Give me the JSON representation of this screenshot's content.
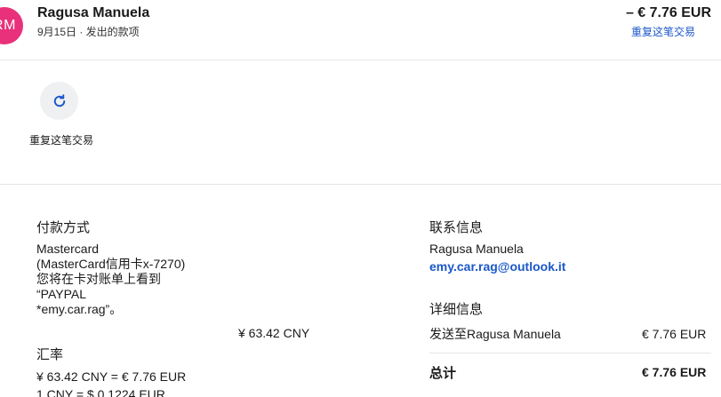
{
  "header": {
    "avatar_initials": "RM",
    "name": "Ragusa Manuela",
    "subtitle": "9月15日 · 发出的款项",
    "amount": "– € 7.76 EUR",
    "repeat_link": "重复这笔交易"
  },
  "actions": {
    "repeat_label": "重复这笔交易"
  },
  "payment": {
    "title": "付款方式",
    "lines": [
      "Mastercard",
      "(MasterCard信用卡x-7270)",
      "您将在卡对账单上看到",
      "“PAYPAL",
      "*emy.car.rag”。"
    ],
    "amount": "¥ 63.42 CNY"
  },
  "exchange": {
    "title": "汇率",
    "line1": "¥ 63.42 CNY = € 7.76 EUR",
    "line2": "1 CNY = $ 0.1224 EUR"
  },
  "contact": {
    "title": "联系信息",
    "name": "Ragusa Manuela",
    "email": "emy.car.rag@outlook.it"
  },
  "details": {
    "title": "详细信息",
    "sent_to_label": "发送至Ragusa Manuela",
    "sent_to_amount": "€ 7.76 EUR",
    "total_label": "总计",
    "total_amount": "€ 7.76 EUR"
  },
  "colors": {
    "avatar": "#e8317a",
    "link": "#1a57c9",
    "divider": "#e6e6e6"
  }
}
